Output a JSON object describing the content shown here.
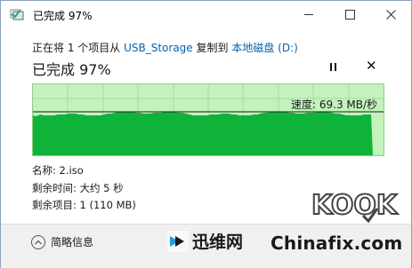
{
  "window": {
    "title": "已完成 97%",
    "min_label": "–",
    "max_label": "□",
    "close_label": "✕"
  },
  "copy": {
    "prefix": "正在将 1 个项目从 ",
    "source": "USB_Storage",
    "middle": " 复制到 ",
    "destination": "本地磁盘 (D:)"
  },
  "status": "已完成 97%",
  "progress_fraction": 0.97,
  "controls": {
    "pause": "pause-icon",
    "cancel": "✕"
  },
  "graph": {
    "speed_label": "速度: 69.3 MB/秒",
    "colors": {
      "background": "#c3f2bc",
      "fill": "#0fb33a",
      "grid": "#a6dca0",
      "line": "#1a1a1a"
    }
  },
  "details": {
    "name": "名称:  2.iso",
    "time_remaining": "剩余时间:  大约 5 秒",
    "items_remaining": "剩余项目:  1 (110 MB)"
  },
  "footer": {
    "collapse_label": "简略信息",
    "collapse_icon": "chevron-up-icon"
  },
  "watermarks": {
    "xunwei": "迅维网",
    "chinafix": "Chinafix.com",
    "kook": "KOOK"
  }
}
